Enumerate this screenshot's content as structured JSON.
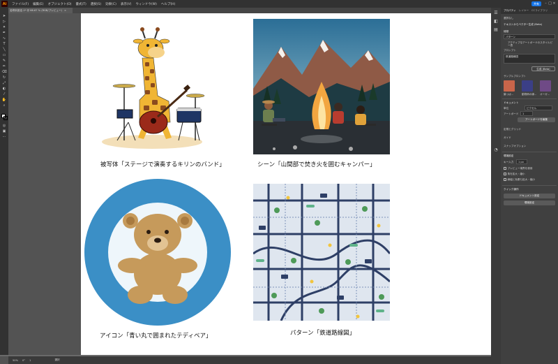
{
  "menubar": {
    "app_icon": "Ai",
    "items": [
      "ファイル(F)",
      "編集(E)",
      "オブジェクト(O)",
      "書式(T)",
      "選択(S)",
      "効果(C)",
      "表示(V)",
      "ウィンドウ(W)",
      "ヘルプ(H)"
    ],
    "share_label": "共有"
  },
  "document_tab": {
    "title": "名称未設定-1* @ 66.67 % (RGB/プレビュー)",
    "close": "×"
  },
  "captions": {
    "subject": "被写体「ステージで演奏するキリンのバンド」",
    "scene": "シーン「山間部で焚き火を囲むキャンパー」",
    "icon": "アイコン「青い丸で囲まれたテディベア」",
    "pattern": "パターン「鉄道路線図」"
  },
  "statusbar": {
    "zoom": "50%",
    "rotation": "0°",
    "artboard": "1",
    "mode": "選択"
  },
  "panel": {
    "tabs": [
      "プロパティ",
      "レイヤー",
      "CCライブラリ"
    ],
    "no_selection": "選択なし",
    "section_title": "テキストからベクター生成 (Beta)",
    "type_label": "種類",
    "type_value": "パターン",
    "type_note": "アクティブなアートボードのスタイルピー表",
    "prompt_label": "プロンプト",
    "prompt_value": "鉄道路線図",
    "generate_label": "生成 (Beta)",
    "samples_label": "サンプルプロンプト",
    "sample_captions": [
      "葉っぱ...",
      "動物柄の線...",
      "オーガ..."
    ],
    "document_header": "ドキュメント",
    "unit_label": "単位",
    "unit_value": "ピクセル",
    "artboard_label": "アートボード",
    "artboard_value": "1",
    "edit_artboard_button": "アートボードを編集",
    "ruler_grid_label": "定規とグリッド",
    "guides_label": "ガイド",
    "snap_label": "スナップオプション",
    "prefs_header": "環境設定",
    "key_increment_label": "キー入力",
    "key_increment_value": "1 px",
    "checkbox_preview_bounds": "プレビュー境界を使用",
    "checkbox_scale_corners": "角を拡大・縮小",
    "checkbox_scale_strokes": "線幅と効果も拡大・縮小",
    "quick_actions_header": "クイック操作",
    "doc_setup_button": "ドキュメント設定",
    "prefs_button": "環境設定"
  },
  "colors": {
    "app_bg": "#535353",
    "toolbar_bg": "#323232",
    "panel_bg": "#404040",
    "accent": "#1473e6",
    "circle_blue": "#3b8fc6",
    "bear_brown": "#c69a5b",
    "giraffe_yellow": "#f0b534"
  },
  "icons": [
    "selection-icon",
    "direct-selection-icon",
    "pen-icon",
    "type-icon",
    "rectangle-icon",
    "brush-icon",
    "zoom-icon",
    "hand-icon",
    "properties-icon",
    "layers-icon",
    "libraries-icon"
  ]
}
